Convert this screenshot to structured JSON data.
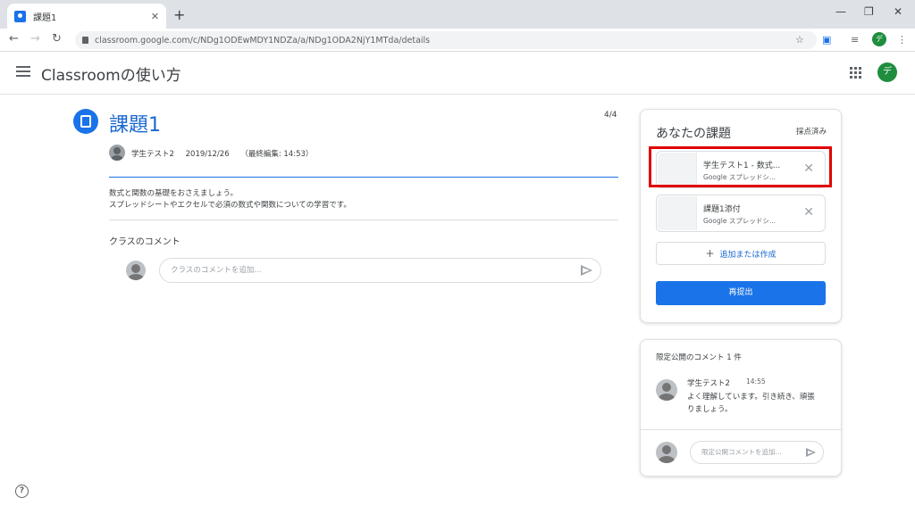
{
  "browser": {
    "tab_title": "課題1",
    "tab_close": "✕",
    "new_tab": "+",
    "url": "classroom.google.com/c/NDg1ODEwMDY1NDZa/a/NDg1ODA2NjY1MTda/details",
    "window_controls": {
      "minimize": "—",
      "restore": "❐",
      "close": "✕"
    },
    "profile_initial": "デ"
  },
  "header": {
    "class_name": "Classroomの使い方",
    "avatar_initial": "デ"
  },
  "assignment": {
    "title": "課題1",
    "count": "4/4",
    "author": "学生テスト2",
    "date": "2019/12/26",
    "edited": "（最終編集: 14:53）",
    "description_line1": "数式と関数の基礎をおさえましょう。",
    "description_line2": "スプレッドシートやエクセルで必須の数式や関数についての学習です。"
  },
  "class_comments": {
    "title": "クラスのコメント",
    "placeholder": "クラスのコメントを追加..."
  },
  "your_work": {
    "title": "あなたの課題",
    "status": "採点済み",
    "attachments": [
      {
        "name": "学生テスト1 - 数式...",
        "type": "Google スプレッドシ..."
      },
      {
        "name": "課題1添付",
        "type": "Google スプレッドシ..."
      }
    ],
    "add_label": "追加または作成",
    "resubmit_label": "再提出"
  },
  "private_comments": {
    "title": "限定公開のコメント 1 件",
    "author": "学生テスト2",
    "time": "14:55",
    "text": "よく理解しています。引き続き、頑張りましょう。",
    "placeholder": "限定公開コメントを追加..."
  },
  "colors": {
    "accent": "#1a73e8",
    "title_blue": "#1967d2",
    "highlight_red": "#e00000",
    "avatar_green": "#1e8e3e"
  }
}
